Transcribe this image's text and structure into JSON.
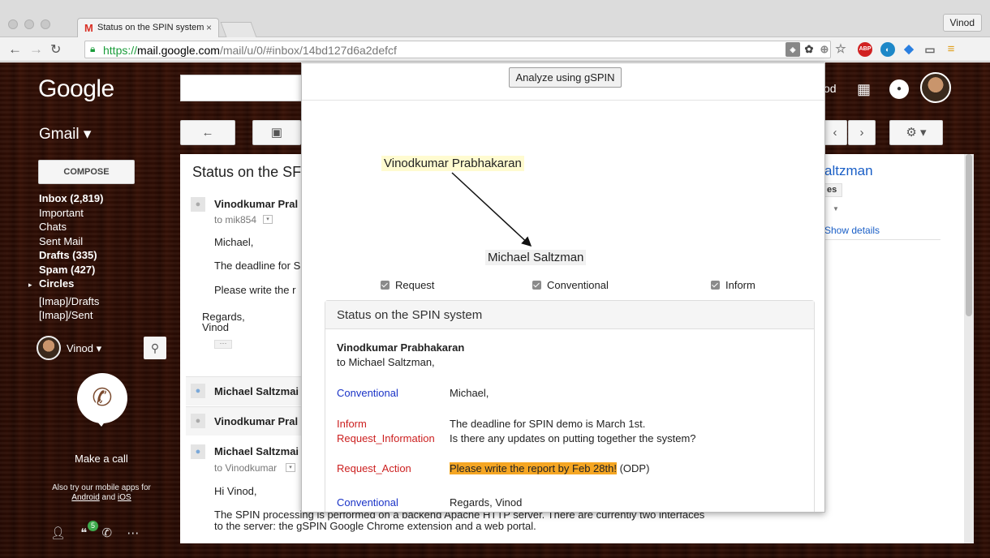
{
  "browser": {
    "tab_title": "Status on the SPIN system",
    "tab_close": "×",
    "user_chip": "Vinod",
    "url_https": "https://",
    "url_host": "mail.google.com",
    "url_path": "/mail/u/0/#inbox/14bd127d6a2defcf",
    "extensions": [
      "gspin-icon",
      "search-icon",
      "star-icon",
      "adblock-icon",
      "ghostery-icon",
      "bluebird-icon",
      "cast-icon",
      "menu-icon"
    ],
    "abp_label": "ABP"
  },
  "gmail": {
    "logo": "Google",
    "product_label": "Gmail ▾",
    "compose_label": "COMPOSE",
    "folders": [
      {
        "label": "Inbox (2,819)",
        "bold": true
      },
      {
        "label": "Important",
        "bold": false
      },
      {
        "label": "Chats",
        "bold": false
      },
      {
        "label": "Sent Mail",
        "bold": false
      },
      {
        "label": "Drafts (335)",
        "bold": true
      },
      {
        "label": "Spam (427)",
        "bold": true
      },
      {
        "label": "Circles",
        "bold": true
      },
      {
        "label": "[Imap]/Drafts",
        "bold": false
      },
      {
        "label": "[Imap]/Sent",
        "bold": false
      }
    ],
    "user_name": "Vinod ▾",
    "make_call": "Make a call",
    "also_try_prefix": "Also try our mobile apps for",
    "android": "Android",
    "and": "and",
    "ios": "iOS",
    "hangouts_badge": "5",
    "header_user_fragment": "od",
    "subject": "Status on the SF",
    "messages": {
      "m1_sender": "Vinodkumar Pral",
      "m1_to": "to mik854",
      "m1_line1": "Michael,",
      "m1_line2": "The deadline for S",
      "m1_line3": "Please write the r",
      "m1_regards": "Regards,",
      "m1_sig": "Vinod",
      "c1_sender": "Michael Saltzmai",
      "c2_sender": "Vinodkumar Pral",
      "m4_sender": "Michael Saltzmai",
      "m4_to": "to Vinodkumar",
      "m4_greeting": "Hi Vinod,",
      "m4_body1": "The SPIN processing is performed on a backend Apache HTTP server. There are currently two interfaces",
      "m4_body2": "to the server: the gSPIN Google Chrome extension and a web portal."
    },
    "right": {
      "name_fragment": "altzman",
      "chip": "es",
      "show_details": "Show details"
    }
  },
  "gspin": {
    "analyze_button": "Analyze using gSPIN",
    "graph_nodes": [
      "Vinodkumar Prabhakaran",
      "Michael Saltzman"
    ],
    "filters": [
      {
        "label": "Request",
        "checked": true
      },
      {
        "label": "Conventional",
        "checked": true
      },
      {
        "label": "Inform",
        "checked": true
      }
    ],
    "panel_title": "Status on the SPIN system",
    "sender": "Vinodkumar Prabhakaran",
    "recipient": "to Michael Saltzman,",
    "rows": [
      {
        "tag": "Conventional",
        "color": "#1a33c7",
        "text": "Michael,"
      },
      {
        "tag": "Inform",
        "color": "#cc1f1f",
        "text": "The deadline for SPIN demo is March 1st."
      },
      {
        "tag": "Request_Information",
        "color": "#cc1f1f",
        "text": "Is there any updates on putting together the system?"
      },
      {
        "tag": "Request_Action",
        "color": "#cc1f1f",
        "text_highlight": "Please write the report by Feb 28th!",
        "text_suffix": " (ODP)"
      },
      {
        "tag": "Conventional",
        "color": "#1a33c7",
        "text": "Regards, Vinod"
      }
    ]
  },
  "colors": {
    "gmail_red": "#d93025",
    "secure_green": "#1a9c3a",
    "highlight_orange": "#f5a623",
    "tag_blue": "#1a33c7",
    "tag_red": "#cc1f1f"
  }
}
